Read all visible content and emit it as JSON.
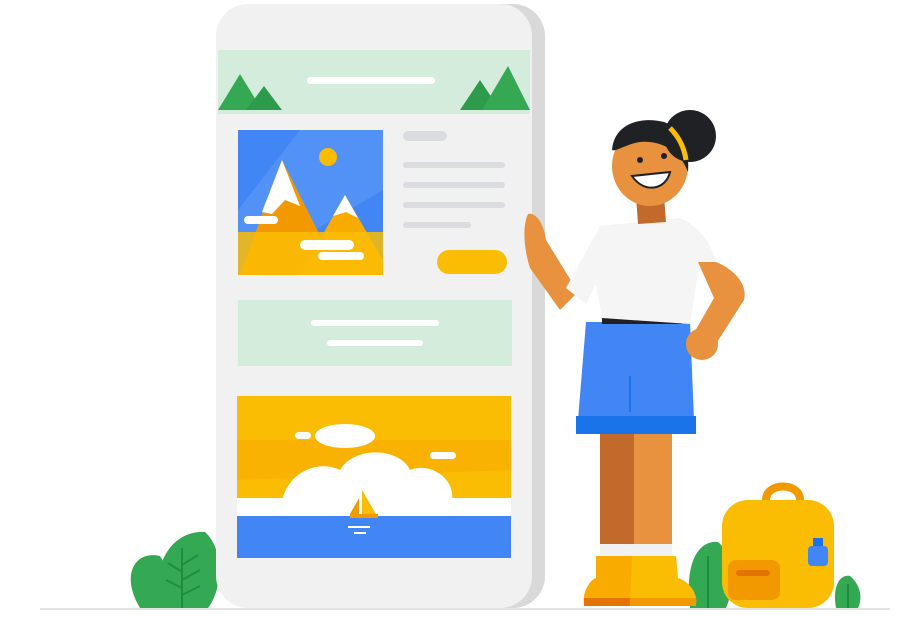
{
  "illustration": {
    "colors": {
      "phone_body": "#f1f1f1",
      "phone_edge": "#d9d9d9",
      "header_band": "#d4ecdc",
      "tree_green": "#34a853",
      "sky_blue": "#4285f4",
      "sun_yellow": "#fbbc04",
      "mountain_orange": "#f29900",
      "skin": "#e8923f",
      "shirt": "#f5f5f5",
      "shorts": "#4285f4",
      "hair": "#202124",
      "placeholder_gray": "#dadce0"
    },
    "icons": [
      "smartphone-icon",
      "mountain-photo-icon",
      "sea-photo-icon",
      "sailboat-icon",
      "sun-icon",
      "person-icon",
      "backpack-icon",
      "bush-icon"
    ]
  }
}
